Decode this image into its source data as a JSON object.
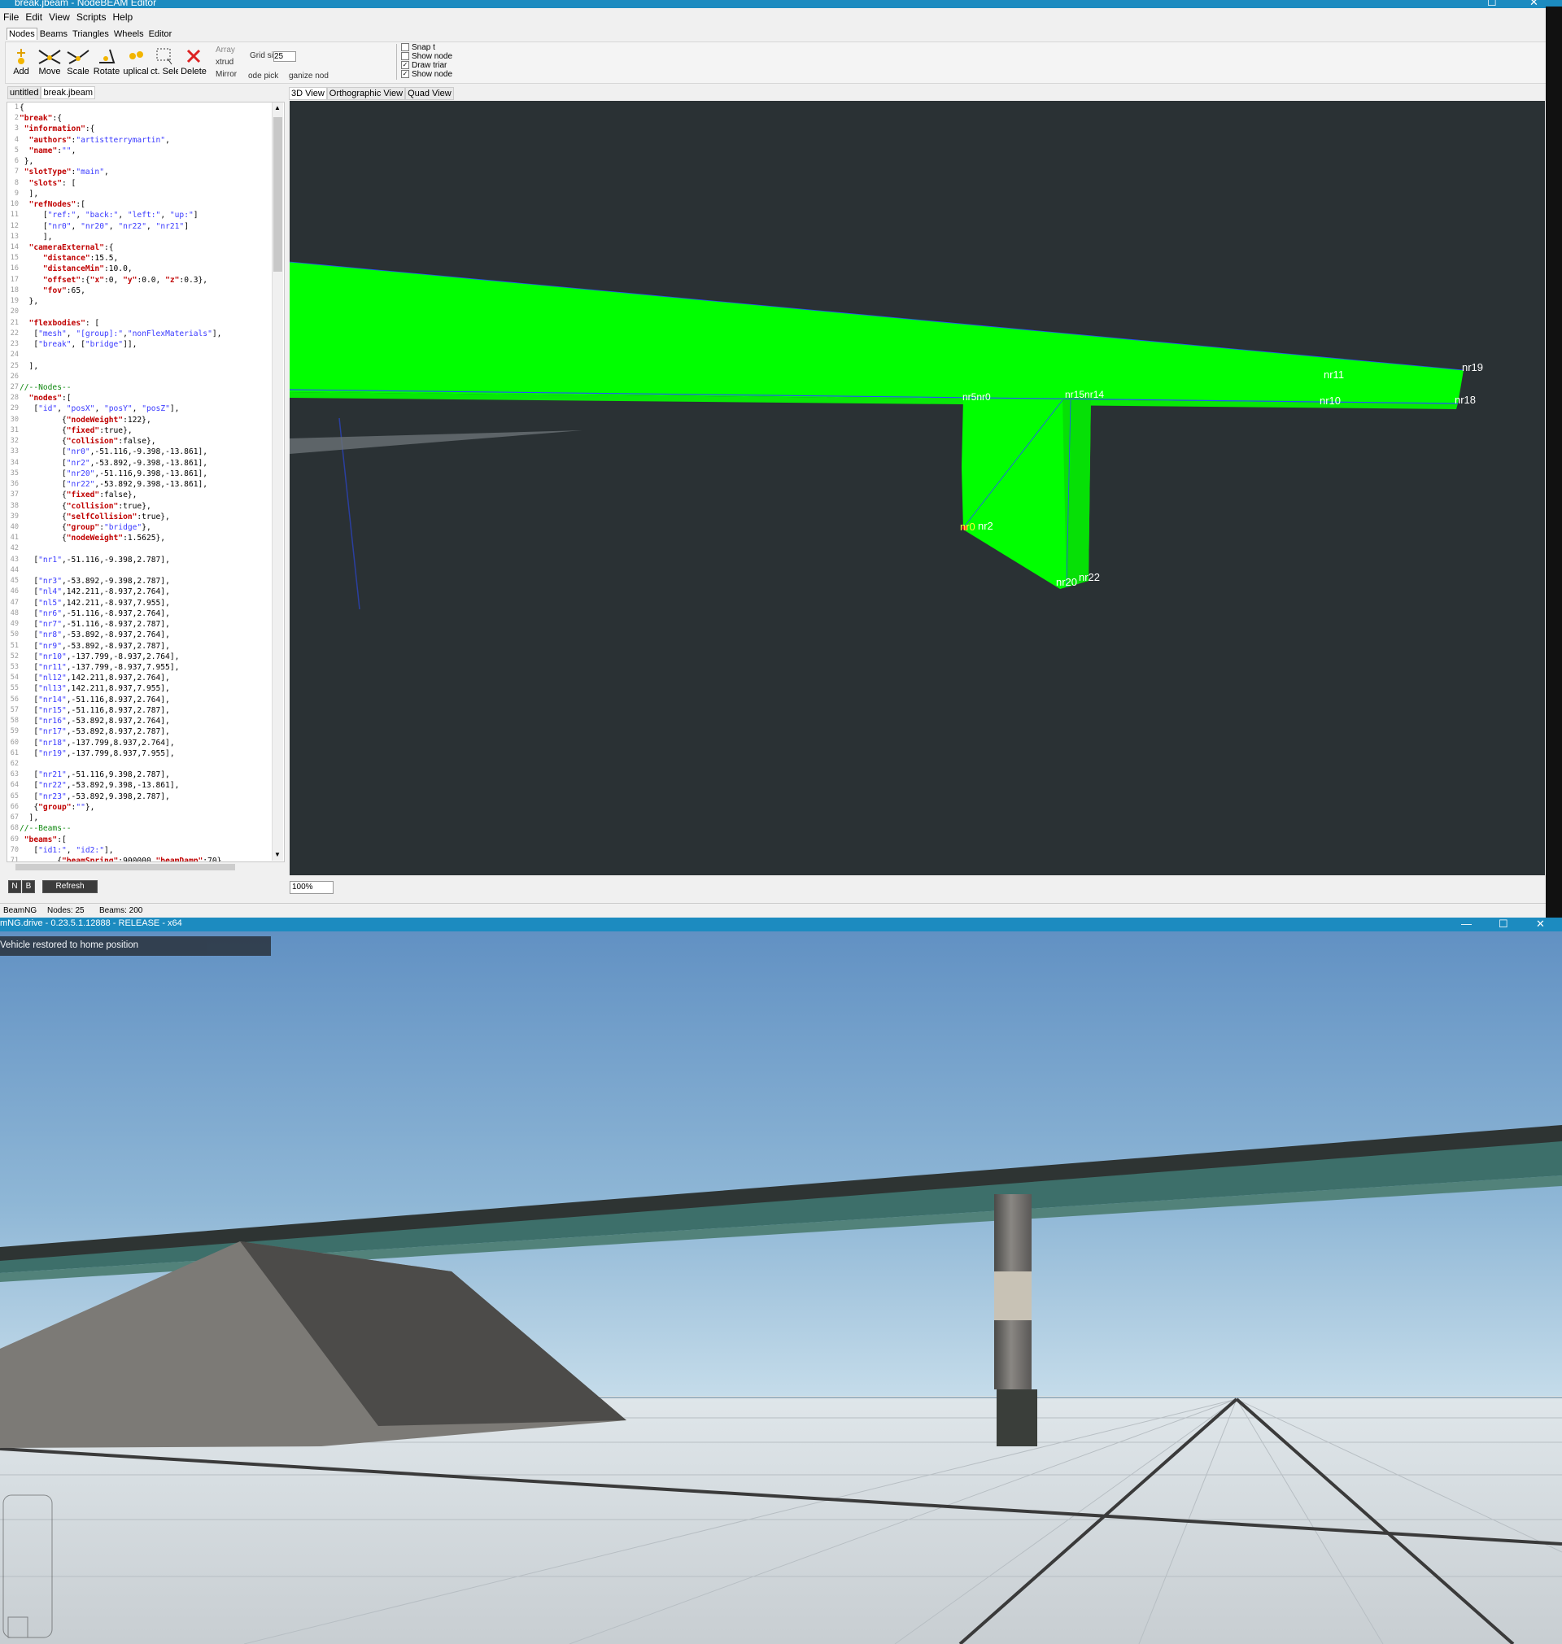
{
  "editor": {
    "title": "break.jbeam - NodeBEAM Editor",
    "menu": [
      "File",
      "Edit",
      "View",
      "Scripts",
      "Help"
    ],
    "ribbon_tabs": [
      "Nodes",
      "Beams",
      "Triangles",
      "Wheels",
      "Editor"
    ],
    "tools": [
      {
        "label": "Add",
        "icon": "add-node-icon"
      },
      {
        "label": "Move",
        "icon": "move-icon"
      },
      {
        "label": "Scale",
        "icon": "scale-icon"
      },
      {
        "label": "Rotate",
        "icon": "rotate-icon"
      },
      {
        "label": "uplical",
        "icon": "duplicate-icon"
      },
      {
        "label": "ct. Sele",
        "icon": "rect-select-icon"
      },
      {
        "label": "Delete",
        "icon": "delete-icon"
      }
    ],
    "ribbon_small": {
      "array": "Array",
      "extrude": "xtrud",
      "mirror": "Mirror",
      "grid_label": "Grid si",
      "grid_value": "25",
      "node_pick": "ode pick",
      "organize": "ganize nod"
    },
    "checkboxes": [
      {
        "label": "Snap t",
        "checked": false
      },
      {
        "label": "Show node",
        "checked": false
      },
      {
        "label": "Draw triar",
        "checked": true
      },
      {
        "label": "Show node",
        "checked": true
      }
    ],
    "file_tabs": [
      "untitled",
      "break.jbeam"
    ],
    "view_tabs": [
      "3D View",
      "Orthographic View",
      "Quad View"
    ],
    "code_lines": [
      "{",
      "\"break\":{",
      " \"information\":{",
      "  \"authors\":\"artistterrymartin\",",
      "  \"name\":\"\",",
      " },",
      " \"slotType\":\"main\",",
      "  \"slots\": [",
      "  ],",
      "  \"refNodes\":[",
      "     [\"ref:\", \"back:\", \"left:\", \"up:\"]",
      "     [\"nr0\", \"nr20\", \"nr22\", \"nr21\"]",
      "     ],",
      "  \"cameraExternal\":{",
      "     \"distance\":15.5,",
      "     \"distanceMin\":10.0,",
      "     \"offset\":{\"x\":0, \"y\":0.0, \"z\":0.3},",
      "     \"fov\":65,",
      "  },",
      "",
      "  \"flexbodies\": [",
      "   [\"mesh\", \"[group]:\",\"nonFlexMaterials\"],",
      "   [\"break\", [\"bridge\"]],",
      "",
      "  ],",
      "",
      "//--Nodes--",
      "  \"nodes\":[",
      "   [\"id\", \"posX\", \"posY\", \"posZ\"],",
      "         {\"nodeWeight\":122},",
      "         {\"fixed\":true},",
      "         {\"collision\":false},",
      "         [\"nr0\",-51.116,-9.398,-13.861],",
      "         [\"nr2\",-53.892,-9.398,-13.861],",
      "         [\"nr20\",-51.116,9.398,-13.861],",
      "         [\"nr22\",-53.892,9.398,-13.861],",
      "         {\"fixed\":false},",
      "         {\"collision\":true},",
      "         {\"selfCollision\":true},",
      "         {\"group\":\"bridge\"},",
      "         {\"nodeWeight\":1.5625},",
      "",
      "   [\"nr1\",-51.116,-9.398,2.787],",
      "",
      "   [\"nr3\",-53.892,-9.398,2.787],",
      "   [\"nl4\",142.211,-8.937,2.764],",
      "   [\"nl5\",142.211,-8.937,7.955],",
      "   [\"nr6\",-51.116,-8.937,2.764],",
      "   [\"nr7\",-51.116,-8.937,2.787],",
      "   [\"nr8\",-53.892,-8.937,2.764],",
      "   [\"nr9\",-53.892,-8.937,2.787],",
      "   [\"nr10\",-137.799,-8.937,2.764],",
      "   [\"nr11\",-137.799,-8.937,7.955],",
      "   [\"nl12\",142.211,8.937,2.764],",
      "   [\"nl13\",142.211,8.937,7.955],",
      "   [\"nr14\",-51.116,8.937,2.764],",
      "   [\"nr15\",-51.116,8.937,2.787],",
      "   [\"nr16\",-53.892,8.937,2.764],",
      "   [\"nr17\",-53.892,8.937,2.787],",
      "   [\"nr18\",-137.799,8.937,2.764],",
      "   [\"nr19\",-137.799,8.937,7.955],",
      "",
      "   [\"nr21\",-51.116,9.398,2.787],",
      "   [\"nr22\",-53.892,9.398,-13.861],",
      "   [\"nr23\",-53.892,9.398,2.787],",
      "   {\"group\":\"\"},",
      "  ],",
      "//--Beams--",
      " \"beams\":[",
      "   [\"id1:\", \"id2:\"],",
      "        {\"beamSpring\":900000,\"beamDamp\":70}"
    ],
    "node_labels": [
      "nr19",
      "nr18",
      "nr11",
      "nr10",
      "nr5nr0",
      "nr15nr14",
      "nr0",
      "nr2",
      "nr20",
      "nr22"
    ],
    "left_buttons": [
      "N",
      "B",
      "Refresh"
    ],
    "zoom": "100%",
    "status": {
      "app": "BeamNG",
      "nodes": "Nodes: 25",
      "beams": "Beams: 200"
    },
    "colors": {
      "accent": "#1c8bc0",
      "viewport_bg": "#2a3134",
      "mesh": "#00ff00"
    }
  },
  "game": {
    "title": "mNG.drive - 0.23.5.1.12888 - RELEASE - x64",
    "toast": "Vehicle restored to home position"
  }
}
